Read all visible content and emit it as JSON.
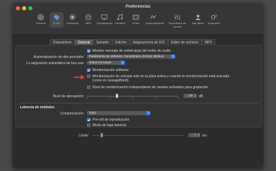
{
  "window": {
    "title": "Preferencias"
  },
  "toolbar": [
    {
      "label": "General",
      "icon": "gear-icon"
    },
    {
      "label": "Audio",
      "icon": "waveform-icon"
    },
    {
      "label": "Grabación",
      "icon": "record-icon"
    },
    {
      "label": "MIDI",
      "icon": "midi-icon"
    },
    {
      "label": "Visualización",
      "icon": "display-icon"
    },
    {
      "label": "Partitura",
      "icon": "score-icon"
    },
    {
      "label": "Vídeo",
      "icon": "film-icon"
    },
    {
      "label": "Automatización",
      "icon": "automation-icon"
    },
    {
      "label": "Superficies de control",
      "icon": "control-surface-icon"
    },
    {
      "label": "Mis datos",
      "icon": "person-icon"
    },
    {
      "label": "Avanzado",
      "icon": "advanced-gear-icon"
    }
  ],
  "tabs": [
    "Dispositivos",
    "General",
    "Sampler",
    "Edición",
    "Asignaciones de E/S",
    "Editor de archivos",
    "MP3"
  ],
  "active_tab": "General",
  "general": {
    "show_overload": "Mostrar mensaje de sobrecarga del motor de audio",
    "automation_label": "Automatización de alta precisión:",
    "automation_value": "Parámetros de Volumen, Panorámica, Envíos, Módulo",
    "bus_label": "La asignación automática de bus usa:",
    "bus_value": "Todos los buses",
    "software_monitoring": "Monitorización software",
    "input_monitoring_line1": "Monitorización de entrada solo en la pista activa y cuando la monitorización está activada",
    "input_monitoring_line2": "(como en GarageBand)",
    "independent_level": "Nivel de monitorización independiente de canales activados para grabación",
    "attenuation_label": "Nivel de atenuación:",
    "attenuation_value": "-20",
    "attenuation_unit": "dB"
  },
  "latency": {
    "heading": "Latencia de módulos",
    "compensation_label": "Compensación:",
    "compensation_value": "Todo",
    "preroll": "Pre-roll de reproducción",
    "low_latency": "Modo de baja latencia",
    "limit_label": "Límite:",
    "limit_value": "5",
    "limit_unit": "ms"
  },
  "colors": {
    "accent": "#2f7cf6",
    "annotation_arrow": "#e8452f"
  }
}
